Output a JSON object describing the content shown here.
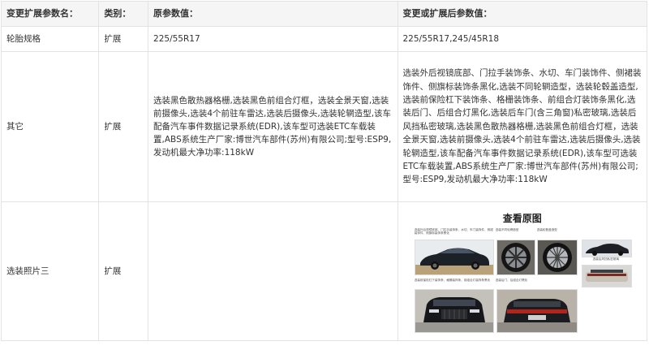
{
  "headers": {
    "param_name": "变更扩展参数名：",
    "category": "类别：",
    "original_value": "原参数值：",
    "new_value": "变更或扩展后参数值："
  },
  "rows": [
    {
      "name": "轮胎规格",
      "category": "扩展",
      "original": "225/55R17",
      "new": "225/55R17,245/45R18"
    },
    {
      "name": "其它",
      "category": "扩展",
      "original": "选装黑色散热器格栅,选装黑色前组合灯框，选装全景天窗,选装前摄像头,选装4个前驻车雷达,选装后摄像头,选装轮辋造型,该车配备汽车事件数据记录系统(EDR),该车型可选装ETC车载装置,ABS系统生产厂家:博世汽车部件(苏州)有限公司;型号:ESP9,发动机最大净功率:118kW",
      "new": "选装外后视镜底部、门拉手装饰条、水切、车门装饰件、侧裙装饰件、侧旗标装饰条黑化,选装不同轮辋造型，选装轮毂盖造型,选装前保险杠下装饰条、格栅装饰条、前组合灯装饰条黑化,选装后门、后组合灯黑化,选装后车门(含三角窗)私密玻璃,选装后风挡私密玻璃,选装黑色散热器格栅,选装黑色前组合灯框，选装全景天窗,选装前摄像头,选装4个前驻车雷达,选装后摄像头,选装轮辋造型,该车配备汽车事件数据记录系统(EDR),该车型可选装ETC车载装置,ABS系统生产厂家:博世汽车部件(苏州)有限公司;型号:ESP9,发动机最大净功率:118kW"
    },
    {
      "name": "选装照片三",
      "category": "扩展",
      "original": "",
      "photo_title": "查看原图"
    }
  ],
  "photo_captions": [
    "选装外后视镜底部、门拉手装饰条、水切、车门装饰件、侧裙装饰件、侧旗标装饰条黑化",
    "选装不同轮辋造型",
    "选装轮毂盖造型",
    "选装后风挡私密玻璃",
    "选装前保险杠下装饰条、格栅装饰条、前组合灯装饰条黑化",
    "选装后门、后组合灯黑化"
  ]
}
